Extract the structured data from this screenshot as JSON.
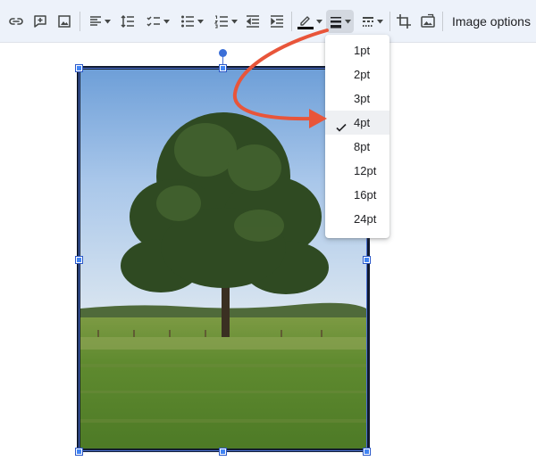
{
  "toolbar": {
    "image_options_label": "Image options",
    "icons": [
      "link-icon",
      "add-comment-icon",
      "insert-image-icon",
      "align-left-icon",
      "line-spacing-icon",
      "checklist-icon",
      "bulleted-list-icon",
      "numbered-list-icon",
      "decrease-indent-icon",
      "increase-indent-icon",
      "border-color-pen-icon",
      "border-weight-icon",
      "border-dash-icon",
      "crop-icon",
      "replace-image-icon"
    ],
    "border_color": "#000000"
  },
  "border_weight_menu": {
    "items": [
      "1pt",
      "2pt",
      "3pt",
      "4pt",
      "8pt",
      "12pt",
      "16pt",
      "24pt"
    ],
    "selected": "4pt"
  },
  "colors": {
    "toolbar_bg": "#edf2fa",
    "selection_blue": "#4285f4",
    "annotation_arrow": "#e8553a",
    "image_border": "#111a2e"
  }
}
